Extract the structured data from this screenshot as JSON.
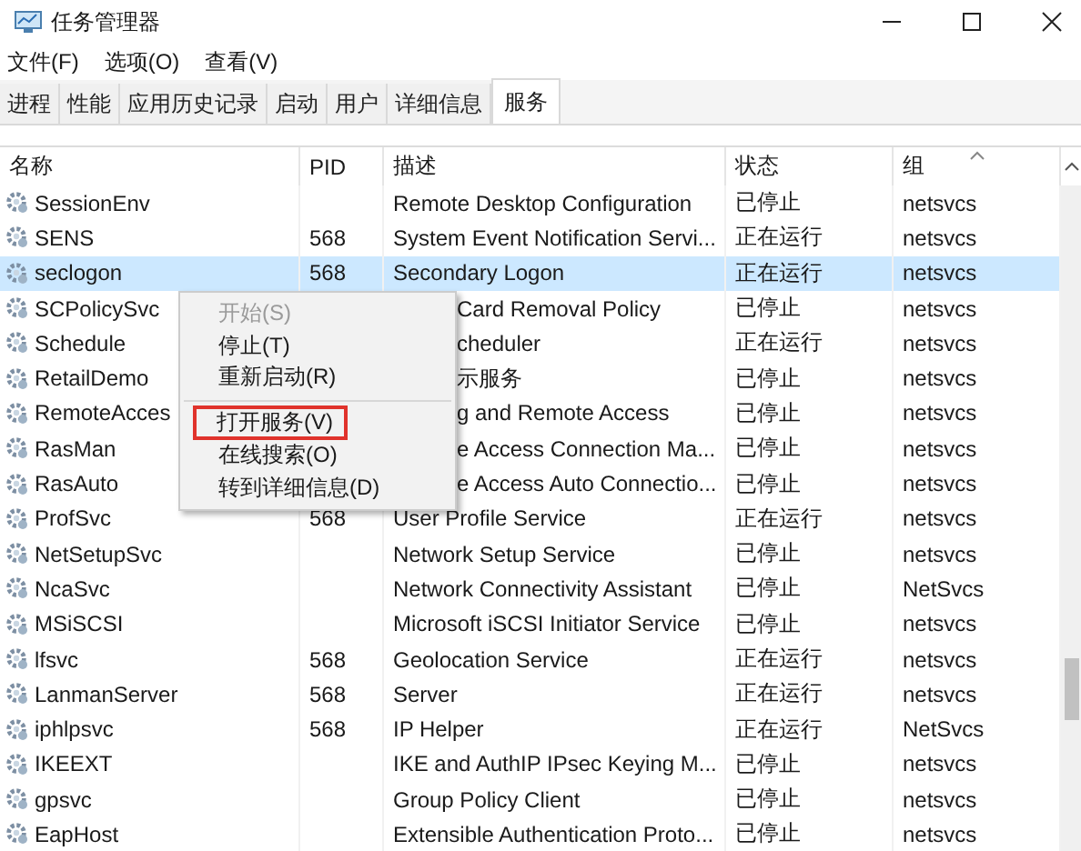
{
  "window": {
    "title": "任务管理器"
  },
  "menu_bar": [
    "文件(F)",
    "选项(O)",
    "查看(V)"
  ],
  "tabs": [
    {
      "label": "进程",
      "selected": false
    },
    {
      "label": "性能",
      "selected": false
    },
    {
      "label": "应用历史记录",
      "selected": false
    },
    {
      "label": "启动",
      "selected": false
    },
    {
      "label": "用户",
      "selected": false
    },
    {
      "label": "详细信息",
      "selected": false
    },
    {
      "label": "服务",
      "selected": true
    }
  ],
  "table": {
    "columns": [
      "名称",
      "PID",
      "描述",
      "状态",
      "组"
    ],
    "rows": [
      {
        "name": "SessionEnv",
        "description": "Remote Desktop Configuration",
        "status": "已停止",
        "group": "netsvcs",
        "selected": false
      },
      {
        "name": "SENS",
        "pid": "568",
        "description": "System Event Notification Servi...",
        "status": "正在运行",
        "group": "netsvcs",
        "selected": false
      },
      {
        "name": "seclogon",
        "pid": "568",
        "description": "Secondary Logon",
        "status": "正在运行",
        "group": "netsvcs",
        "selected": true
      },
      {
        "name": "SCPolicySvc",
        "description": "Card Removal Policy",
        "cut": true,
        "status": "已停止",
        "group": "netsvcs",
        "selected": false
      },
      {
        "name": "Schedule",
        "description": "cheduler",
        "cut": true,
        "status": "正在运行",
        "group": "netsvcs",
        "selected": false
      },
      {
        "name": "RetailDemo",
        "description": "示服务",
        "cut": true,
        "status": "已停止",
        "group": "netsvcs",
        "selected": false
      },
      {
        "name": "RemoteAcces",
        "description": "g and Remote Access",
        "cut": true,
        "status": "已停止",
        "group": "netsvcs",
        "selected": false
      },
      {
        "name": "RasMan",
        "description": "e Access Connection Ma...",
        "cut": true,
        "status": "已停止",
        "group": "netsvcs",
        "selected": false
      },
      {
        "name": "RasAuto",
        "description": "e Access Auto Connectio...",
        "cut": true,
        "status": "已停止",
        "group": "netsvcs",
        "selected": false
      },
      {
        "name": "ProfSvc",
        "pid": "568",
        "description": "User Profile Service",
        "status": "正在运行",
        "group": "netsvcs",
        "selected": false
      },
      {
        "name": "NetSetupSvc",
        "description": "Network Setup Service",
        "status": "已停止",
        "group": "netsvcs",
        "selected": false
      },
      {
        "name": "NcaSvc",
        "description": "Network Connectivity Assistant",
        "status": "已停止",
        "group": "NetSvcs",
        "selected": false
      },
      {
        "name": "MSiSCSI",
        "description": "Microsoft iSCSI Initiator Service",
        "status": "已停止",
        "group": "netsvcs",
        "selected": false
      },
      {
        "name": "lfsvc",
        "pid": "568",
        "description": "Geolocation Service",
        "status": "正在运行",
        "group": "netsvcs",
        "selected": false
      },
      {
        "name": "LanmanServer",
        "pid": "568",
        "description": "Server",
        "status": "正在运行",
        "group": "netsvcs",
        "selected": false
      },
      {
        "name": "iphlpsvc",
        "pid": "568",
        "description": "IP Helper",
        "status": "正在运行",
        "group": "NetSvcs",
        "selected": false
      },
      {
        "name": "IKEEXT",
        "description": "IKE and AuthIP IPsec Keying M...",
        "status": "已停止",
        "group": "netsvcs",
        "selected": false
      },
      {
        "name": "gpsvc",
        "description": "Group Policy Client",
        "status": "已停止",
        "group": "netsvcs",
        "selected": false
      },
      {
        "name": "EapHost",
        "description": "Extensible Authentication Proto...",
        "status": "已停止",
        "group": "netsvcs",
        "selected": false
      }
    ]
  },
  "context_menu": [
    {
      "kind": "item",
      "label": "开始(S)",
      "disabled": true,
      "highlighted": false
    },
    {
      "kind": "item",
      "label": "停止(T)",
      "disabled": false,
      "highlighted": false
    },
    {
      "kind": "item",
      "label": "重新启动(R)",
      "disabled": false,
      "highlighted": false
    },
    {
      "kind": "separator"
    },
    {
      "kind": "item",
      "label": "打开服务(V)",
      "disabled": false,
      "highlighted": true
    },
    {
      "kind": "item",
      "label": "在线搜索(O)",
      "disabled": false,
      "highlighted": false
    },
    {
      "kind": "item",
      "label": "转到详细信息(D)",
      "disabled": false,
      "highlighted": false
    }
  ]
}
